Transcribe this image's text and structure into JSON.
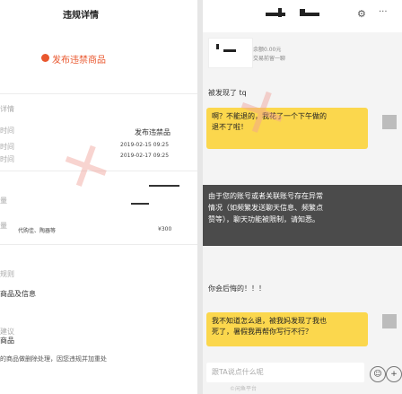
{
  "left": {
    "title": "违规详情",
    "warning": "发布违禁商品",
    "labels": [
      "详情",
      "时间",
      "时间",
      "时间",
      "量",
      "量",
      "量"
    ],
    "seller_name": "发布违禁品",
    "time_1": "2019-02-15 09:25",
    "time_2": "2019-02-17 09:25",
    "product_text": "代购佳、陶器等",
    "price": "¥300",
    "section_1": "规则",
    "section_2": "商品及信息",
    "section_3": "商品",
    "section_4": "建议",
    "footer": "的商品做删除处理，因您违规并加重处"
  },
  "right": {
    "header_sub_1": "余额0.00元",
    "header_sub_2": "交易前留一聊",
    "note_1": "被发现了 tq",
    "bubble_1": "啊？不能退的，我花了一个下午做的\n退不了啦！",
    "restriction": "由于您的账号或者关联账号存在异常\n情况（如频繁发送聊天信息、频繁点\n赞等），聊天功能被限制，请知悉。",
    "note_2": "你会后悔的！！！",
    "bubble_2": "我不知道怎么退，被我妈发现了我也\n死了，暑假我再帮你写行不行？",
    "input_placeholder": "跟TA说点什么呢",
    "input_sub": "©闲鱼平台"
  },
  "icons": [
    "warning-dot-icon",
    "gear-icon",
    "more-dots-icon",
    "emoji-icon",
    "add-icon"
  ]
}
